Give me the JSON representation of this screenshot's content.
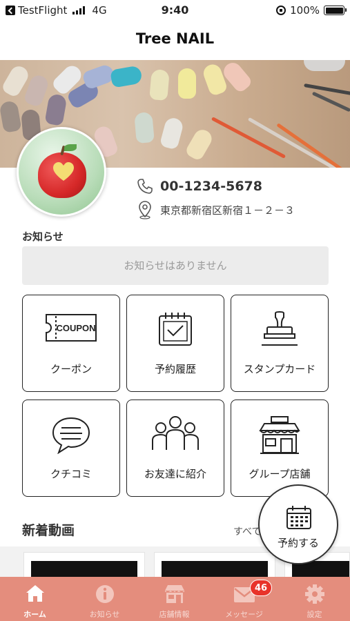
{
  "status_bar": {
    "carrier": "TestFlight",
    "network": "4G",
    "time": "9:40",
    "battery": "100%"
  },
  "header": {
    "title": "Tree NAIL"
  },
  "shop": {
    "phone": "00-1234-5678",
    "address": "東京都新宿区新宿１－２－３"
  },
  "news": {
    "label": "お知らせ",
    "empty_message": "お知らせはありません"
  },
  "menu": {
    "coupon_icon_text": "COUPON",
    "items": [
      {
        "label": "クーポン",
        "icon": "coupon-icon"
      },
      {
        "label": "予約履歴",
        "icon": "calendar-check-icon"
      },
      {
        "label": "スタンプカード",
        "icon": "stamp-icon"
      },
      {
        "label": "クチコミ",
        "icon": "chat-bubble-icon"
      },
      {
        "label": "お友達に紹介",
        "icon": "friends-icon"
      },
      {
        "label": "グループ店舗",
        "icon": "storefront-icon"
      }
    ]
  },
  "videos": {
    "title": "新着動画",
    "see_all": "すべて"
  },
  "fab": {
    "label": "予約する",
    "icon": "calendar-icon"
  },
  "tabbar": {
    "items": [
      {
        "label": "ホーム",
        "icon": "home-icon",
        "active": true
      },
      {
        "label": "お知らせ",
        "icon": "info-icon",
        "active": false
      },
      {
        "label": "店舗情報",
        "icon": "store-icon",
        "active": false
      },
      {
        "label": "メッセージ",
        "icon": "mail-icon",
        "active": false,
        "badge": "46"
      },
      {
        "label": "設定",
        "icon": "gear-icon",
        "active": false
      }
    ]
  },
  "colors": {
    "tabbar": "#e48d7d",
    "badge": "#e8332a",
    "notice_box": "#ececec"
  }
}
